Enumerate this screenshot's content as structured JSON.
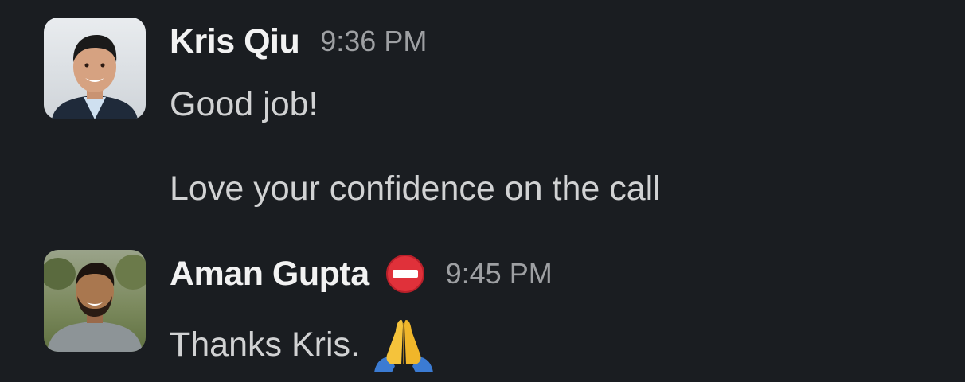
{
  "messages": [
    {
      "author": "Kris Qiu",
      "time": "9:36 PM",
      "lines": [
        "Good job!",
        "Love your confidence on the call"
      ],
      "avatar_icon": "person-photo-avatar"
    },
    {
      "author": "Aman Gupta",
      "time": "9:45 PM",
      "status_icon": "no-entry-icon",
      "lines": [
        "Thanks Kris."
      ],
      "emoji": "folded-hands-icon",
      "avatar_icon": "person-photo-avatar"
    }
  ],
  "colors": {
    "background": "#1a1d21",
    "author": "#f2f2f2",
    "timestamp": "#9ea0a3",
    "message_text": "#d1d2d3",
    "status_red": "#e0313a",
    "emoji_yellow": "#f5c33b"
  }
}
